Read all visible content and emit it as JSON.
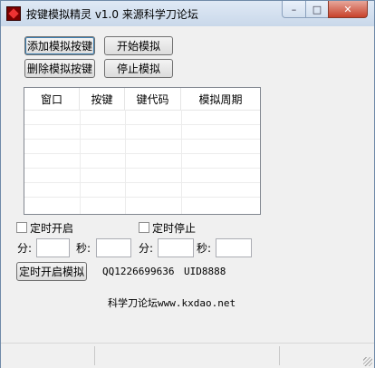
{
  "window": {
    "title": "按键模拟精灵 v1.0  来源科学刀论坛"
  },
  "titlebar": {
    "minimize_glyph": "–",
    "maximize_glyph": "□",
    "close_glyph": "✕"
  },
  "buttons": {
    "add": "添加模拟按键",
    "start": "开始模拟",
    "delete": "删除模拟按键",
    "stop": "停止模拟",
    "timer_start": "定时开启模拟"
  },
  "list": {
    "columns": [
      "窗口",
      "按键",
      "键代码",
      "模拟周期"
    ],
    "rows": []
  },
  "timer": {
    "start_check_label": "定时开启",
    "stop_check_label": "定时停止",
    "min_label": "分:",
    "sec_label": "秒:",
    "start_min_value": "",
    "start_sec_value": "",
    "stop_min_value": "",
    "stop_sec_value": ""
  },
  "info": {
    "qq": "QQ1226699636",
    "uid": "UID8888",
    "site": "科学刀论坛www.kxdao.net"
  }
}
